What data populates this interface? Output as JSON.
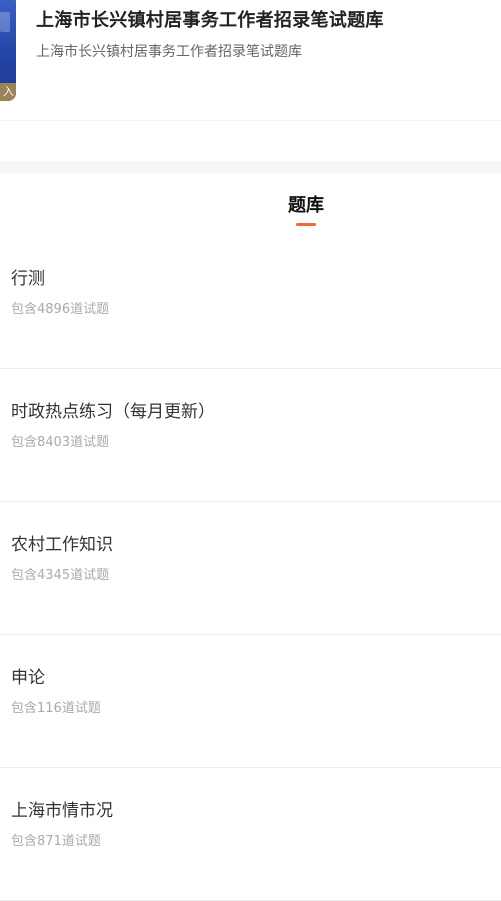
{
  "header": {
    "cover_badge": "入",
    "title": "上海市长兴镇村居事务工作者招录笔试题库",
    "subtitle": "上海市长兴镇村居事务工作者招录笔试题库"
  },
  "tab": {
    "title": "题库",
    "indicator_color": "#ee6a3a"
  },
  "banks": [
    {
      "name": "行测",
      "count": "包含4896道试题"
    },
    {
      "name": "时政热点练习（每月更新）",
      "count": "包含8403道试题"
    },
    {
      "name": "农村工作知识",
      "count": "包含4345道试题"
    },
    {
      "name": "申论",
      "count": "包含116道试题"
    },
    {
      "name": "上海市情市况",
      "count": "包含871道试题"
    }
  ]
}
